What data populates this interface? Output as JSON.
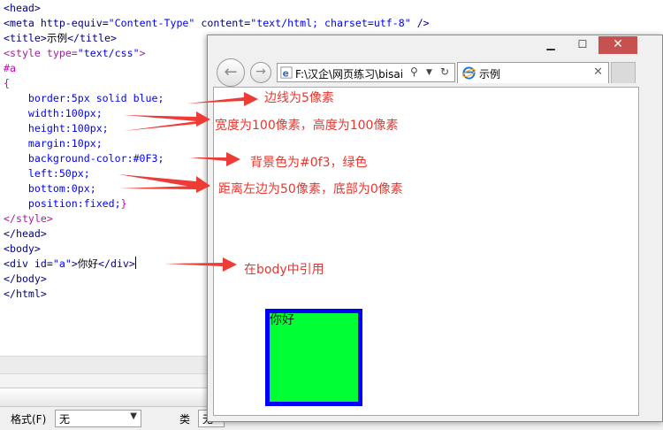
{
  "code": {
    "line_head_open": "<head>",
    "meta_tag_open": "<meta ",
    "meta_attr1": "http-equiv=",
    "meta_val1": "\"Content-Type\"",
    "meta_attr2": " content=",
    "meta_val2": "\"text/html; charset=utf-8\"",
    "meta_close": " />",
    "title_open": "<title>",
    "title_text": "示例",
    "title_close": "</title>",
    "style_open": "<style ",
    "style_attr": "type=",
    "style_val": "\"text/css\"",
    "style_gt": ">",
    "selector": "#a",
    "brace_open": "{",
    "prop_border": "    border:5px solid blue;",
    "prop_width": "    width:100px;",
    "prop_height": "    height:100px;",
    "prop_margin": "    margin:10px;",
    "prop_bg": "    background-color:#0F3;",
    "prop_left": "    left:50px;",
    "prop_bottom": "    bottom:0px;",
    "prop_position": "    position:fixed;",
    "brace_close": "}",
    "style_close": "</style>",
    "head_close": "</head>",
    "body_open": "<body>",
    "div_open": "<div ",
    "div_attr": "id=",
    "div_val": "\"a\"",
    "div_gt": ">",
    "div_text": "你好",
    "div_close": "</div>",
    "body_close": "</body>",
    "html_close": "</html>"
  },
  "browser": {
    "address": "F:\\汉企\\网页练习\\bisai",
    "tab_title": "示例",
    "rendered_text": "你好",
    "div_background": "#00ff33",
    "div_border_color": "#0000ff"
  },
  "annotations": {
    "border_note": "边线为5像素",
    "size_note": "宽度为100像素，高度为100像素",
    "bg_note": "背景色为#0f3，绿色",
    "position_note": "距离左边为50像素，底部为0像素",
    "body_note": "在body中引用",
    "color": "#e8352e"
  },
  "properties_panel": {
    "format_label": "格式(F)",
    "format_value": "无",
    "class_label": "类",
    "class_value": "无"
  },
  "icons": [
    "back-arrow-icon",
    "forward-arrow-icon",
    "ie-logo-icon",
    "search-icon",
    "refresh-icon",
    "close-icon",
    "minimize-icon",
    "maximize-icon"
  ]
}
